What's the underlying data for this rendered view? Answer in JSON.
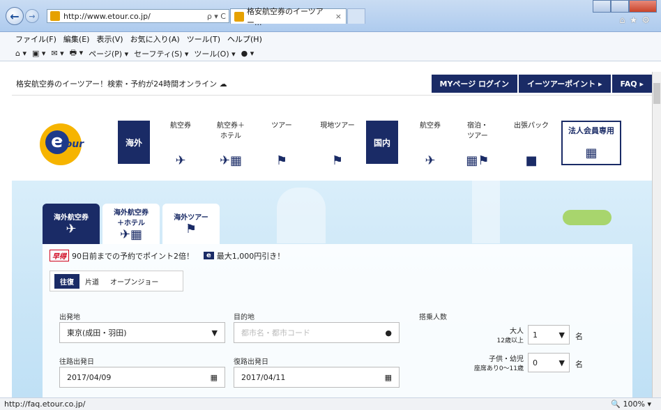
{
  "browser": {
    "url": "http://www.etour.co.jp/",
    "tab_title": "格安航空券のイーツアー...",
    "tab_close": "×",
    "addr_tools": "ρ ▾ C",
    "menu": [
      "ファイル(F)",
      "編集(E)",
      "表示(V)",
      "お気に入り(A)",
      "ツール(T)",
      "ヘルプ(H)"
    ],
    "cmd": [
      "⌂ ▾",
      "▣ ▾",
      "✉ ▾",
      "🖶 ▾",
      "ページ(P) ▾",
      "セーフティ(S) ▾",
      "ツール(O) ▾",
      "● ▾"
    ],
    "status_url": "http://faq.etour.co.jp/",
    "zoom": "100%"
  },
  "topbar": {
    "tagline": "格安航空券のイーツアー！検索・予約が24時間オンライン",
    "links": [
      "MYページ ログイン",
      "イーツアーポイント ▸",
      "FAQ ▸"
    ]
  },
  "logo": {
    "e": "e",
    "tour": "tour"
  },
  "nav": {
    "overseas": "海外",
    "domestic": "国内",
    "items_overseas": [
      {
        "l1": "航空券",
        "l2": "",
        "icon": "plane-icon",
        "glyph": "✈"
      },
      {
        "l1": "航空券＋",
        "l2": "ホテル",
        "icon": "plane-hotel-icon",
        "glyph": "✈▦"
      },
      {
        "l1": "ツアー",
        "l2": "",
        "icon": "flag-icon",
        "glyph": "⚑"
      },
      {
        "l1": "現地ツアー",
        "l2": "",
        "icon": "flag-icon",
        "glyph": "⚑"
      }
    ],
    "items_domestic": [
      {
        "l1": "航空券",
        "l2": "",
        "icon": "plane-icon",
        "glyph": "✈"
      },
      {
        "l1": "宿泊・",
        "l2": "ツアー",
        "icon": "hotel-flag-icon",
        "glyph": "▦⚑"
      },
      {
        "l1": "出張パック",
        "l2": "",
        "icon": "briefcase-icon",
        "glyph": "■"
      }
    ],
    "corp": "法人会員専用"
  },
  "search": {
    "tabs": [
      {
        "l1": "海外航空券",
        "l2": "",
        "glyph": "✈"
      },
      {
        "l1": "海外航空券",
        "l2": "＋ホテル",
        "glyph": "✈▦"
      },
      {
        "l1": "海外ツアー",
        "l2": "",
        "glyph": "⚑"
      }
    ],
    "promo_badge": "早得",
    "promo_text": "90日前までの予約でポイント2倍！",
    "promo_e": "e",
    "promo_text2": "最大1,000円引き！",
    "trip_types": [
      "往復",
      "片道",
      "オープンジョー"
    ],
    "origin_label": "出発地",
    "origin_value": "東京(成田・羽田)",
    "dest_label": "目的地",
    "dest_placeholder": "都市名・都市コード",
    "pax_label": "搭乗人数",
    "adult_label": "大人",
    "adult_sub": "12歳以上",
    "adult_value": "1",
    "child_label": "子供・幼児",
    "child_sub": "座席あり0〜11歳",
    "child_value": "0",
    "unit": "名",
    "dep_label": "往路出発日",
    "dep_value": "2017/04/09",
    "ret_label": "復路出発日",
    "ret_value": "2017/04/11"
  },
  "colors": {
    "navy": "#1a2b66",
    "accent": "#f6b400"
  }
}
